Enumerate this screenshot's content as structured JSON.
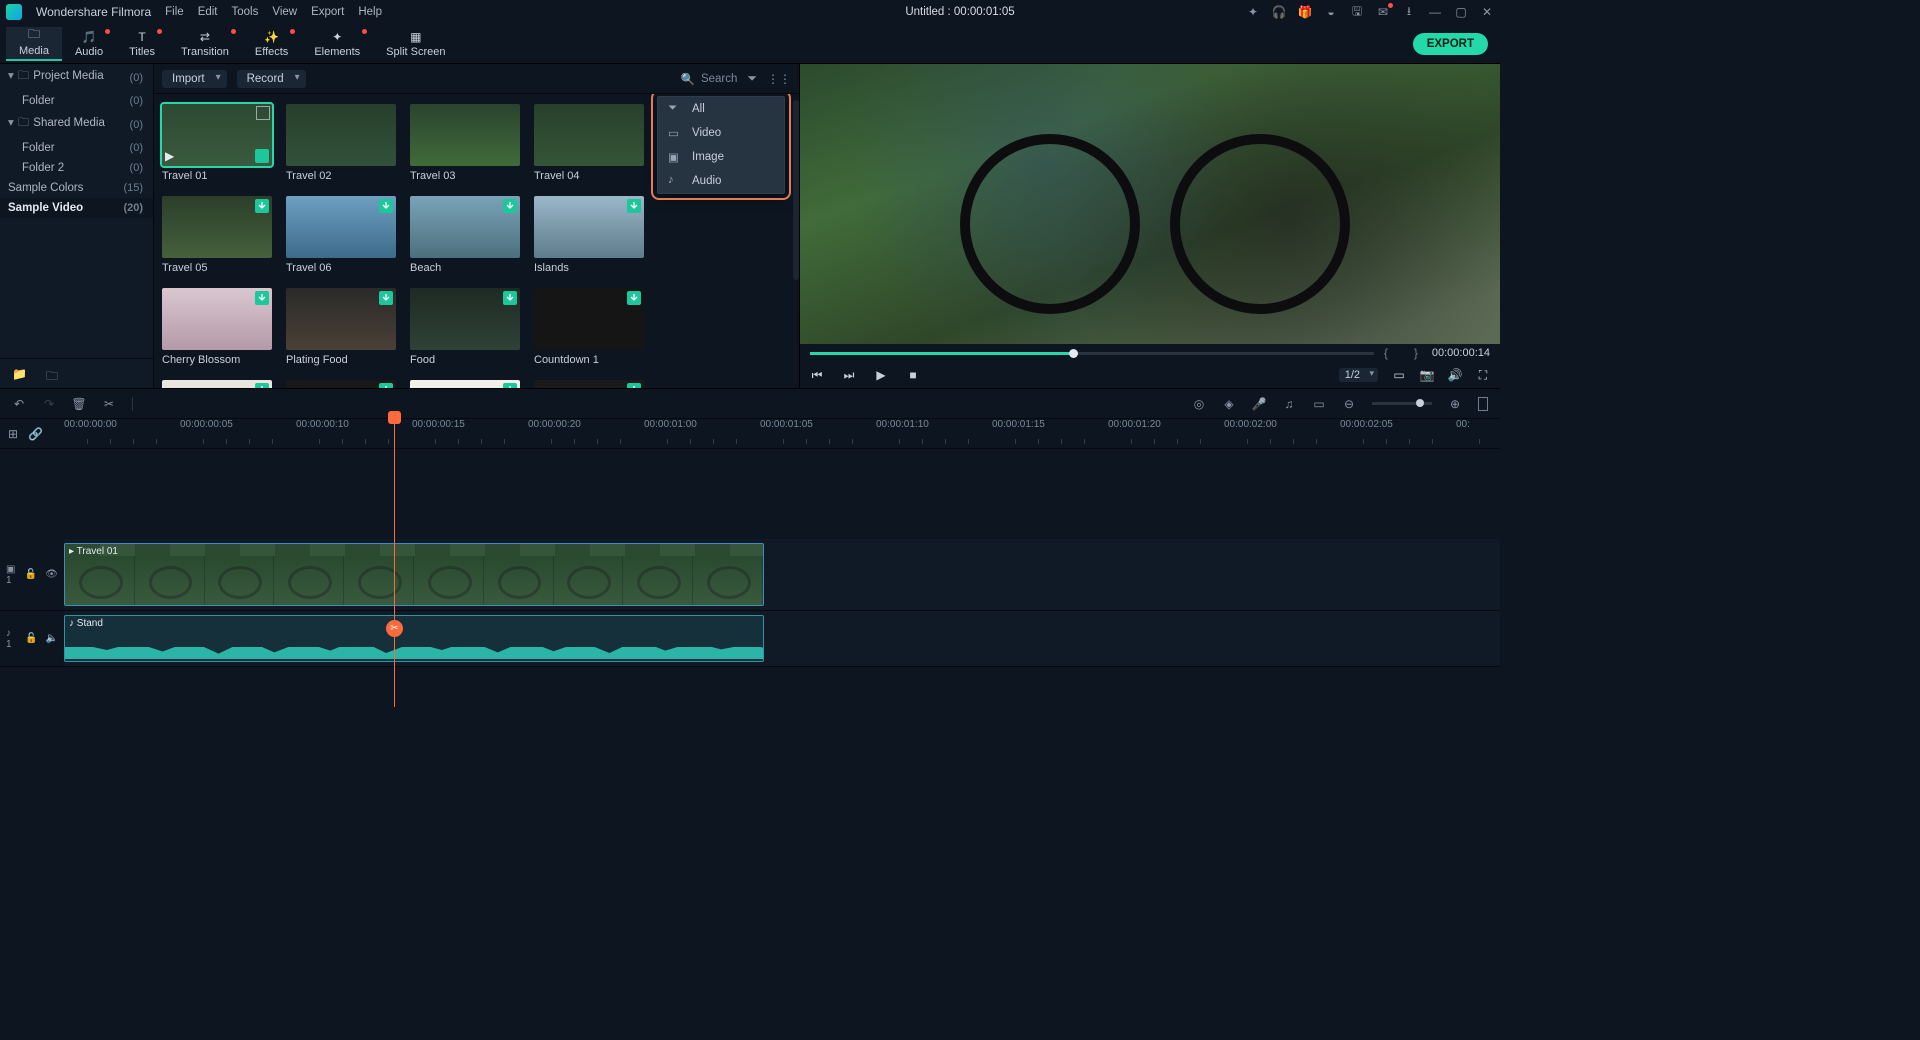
{
  "title_bar": {
    "app_name": "Wondershare Filmora",
    "menu": [
      "File",
      "Edit",
      "Tools",
      "View",
      "Export",
      "Help"
    ],
    "doc_title": "Untitled : 00:00:01:05"
  },
  "tabs": [
    {
      "label": "Media",
      "active": true,
      "dot": false
    },
    {
      "label": "Audio",
      "active": false,
      "dot": true
    },
    {
      "label": "Titles",
      "active": false,
      "dot": true
    },
    {
      "label": "Transition",
      "active": false,
      "dot": true
    },
    {
      "label": "Effects",
      "active": false,
      "dot": true
    },
    {
      "label": "Elements",
      "active": false,
      "dot": true
    },
    {
      "label": "Split Screen",
      "active": false,
      "dot": false
    }
  ],
  "export_label": "EXPORT",
  "sidebar": {
    "items": [
      {
        "label": "Project Media",
        "count": "(0)",
        "expandable": true,
        "indent": false
      },
      {
        "label": "Folder",
        "count": "(0)",
        "expandable": false,
        "indent": true
      },
      {
        "label": "Shared Media",
        "count": "(0)",
        "expandable": true,
        "indent": false
      },
      {
        "label": "Folder",
        "count": "(0)",
        "expandable": false,
        "indent": true
      },
      {
        "label": "Folder 2",
        "count": "(0)",
        "expandable": false,
        "indent": true
      },
      {
        "label": "Sample Colors",
        "count": "(15)",
        "expandable": false,
        "indent": false
      },
      {
        "label": "Sample Video",
        "count": "(20)",
        "expandable": false,
        "indent": false,
        "selected": true
      }
    ]
  },
  "media_toolbar": {
    "import_label": "Import",
    "record_label": "Record",
    "search_placeholder": "Search"
  },
  "filter_menu": {
    "items": [
      "All",
      "Video",
      "Image",
      "Audio"
    ]
  },
  "thumbs": [
    {
      "label": "Travel 01",
      "selected": true,
      "dl": false,
      "check": true,
      "hd": true,
      "bg": "linear-gradient(#2c4a32,#3a5a3e)"
    },
    {
      "label": "Travel 02",
      "bg": "linear-gradient(#273f2c,#32513a)"
    },
    {
      "label": "Travel 03",
      "bg": "linear-gradient(#2a432e,#416b3a)"
    },
    {
      "label": "Travel 04",
      "bg": "linear-gradient(#27402b,#365538)"
    },
    {
      "label": "Travel 05",
      "dl": true,
      "bg": "linear-gradient(#2b3e2a,#46603c)"
    },
    {
      "label": "Travel 06",
      "dl": true,
      "bg": "linear-gradient(#6ea0c2,#3d6b8a)"
    },
    {
      "label": "Beach",
      "dl": true,
      "bg": "linear-gradient(#7aa3b8,#4c6f7d)"
    },
    {
      "label": "Islands",
      "dl": true,
      "bg": "linear-gradient(#9bb7c9,#5e7c8c)"
    },
    {
      "label": "Cherry Blossom",
      "dl": true,
      "bg": "linear-gradient(#d9c7d0,#b49aa8)"
    },
    {
      "label": "Plating Food",
      "dl": true,
      "bg": "linear-gradient(#2a2a2a,#4a4036)"
    },
    {
      "label": "Food",
      "dl": true,
      "bg": "linear-gradient(#1e2a24,#2f4236)"
    },
    {
      "label": "Countdown 1",
      "dl": true,
      "bg": "#151515"
    },
    {
      "label": "",
      "dl": true,
      "bg": "#e8e6df"
    },
    {
      "label": "",
      "dl": true,
      "bg": "#181818"
    },
    {
      "label": "",
      "dl": true,
      "bg": "#f2f0ea"
    },
    {
      "label": "",
      "dl": true,
      "bg": "#1a1a1a"
    }
  ],
  "preview": {
    "time_total": "00:00:00:14",
    "zoom": "1/2"
  },
  "ruler": {
    "labels": [
      "00:00:00:00",
      "00:00:00:05",
      "00:00:00:10",
      "00:00:00:15",
      "00:00:00:20",
      "00:00:01:00",
      "00:00:01:05",
      "00:00:01:10",
      "00:00:01:15",
      "00:00:01:20",
      "00:00:02:00",
      "00:00:02:05",
      "00:"
    ]
  },
  "tracks": {
    "video_clip_label": "Travel 01",
    "audio_clip_label": "Stand",
    "video_head": "▣ 1",
    "audio_head": "♪ 1"
  }
}
